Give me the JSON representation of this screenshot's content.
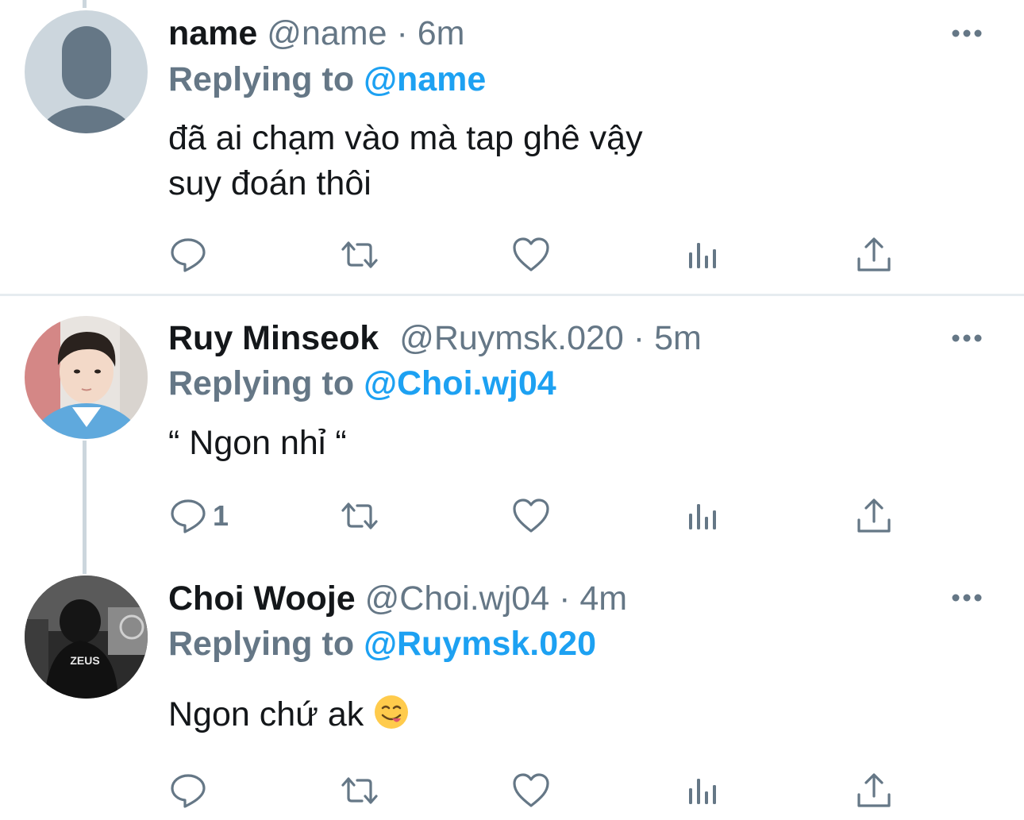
{
  "tweets": [
    {
      "name": "name",
      "handle": "@name",
      "dot": "·",
      "time": "6m",
      "replying_label": "Replying to",
      "replying_to": "@name",
      "text_lines": [
        "đã ai chạm vào mà tap ghê vậy",
        "suy đoán thôi"
      ],
      "reply_count": "",
      "avatar": "default-avatar"
    },
    {
      "name": "Ruy Minseok",
      "handle": "@Ruymsk.020",
      "dot": "·",
      "time": "5m",
      "replying_label": "Replying to",
      "replying_to": "@Choi.wj04",
      "text_lines": [
        "“ Ngon nhỉ “"
      ],
      "reply_count": "1",
      "avatar": "photo-avatar"
    },
    {
      "name": "Choi Wooje",
      "handle": "@Choi.wj04",
      "dot": "·",
      "time": "4m",
      "replying_label": "Replying to",
      "replying_to": "@Ruymsk.020",
      "text_lines": [
        "Ngon chứ ak"
      ],
      "text_emoji": "yum-emoji",
      "reply_count": "",
      "avatar": "photo-avatar-zeus",
      "avatar_shirt_text": "ZEUS"
    }
  ],
  "icons": [
    "reply-icon",
    "retweet-icon",
    "like-icon",
    "analytics-icon",
    "share-icon",
    "more-icon"
  ],
  "colors": {
    "accent": "#1da1f2",
    "secondary": "#657786",
    "icon": "#657786",
    "divider": "#e6ecf0"
  }
}
